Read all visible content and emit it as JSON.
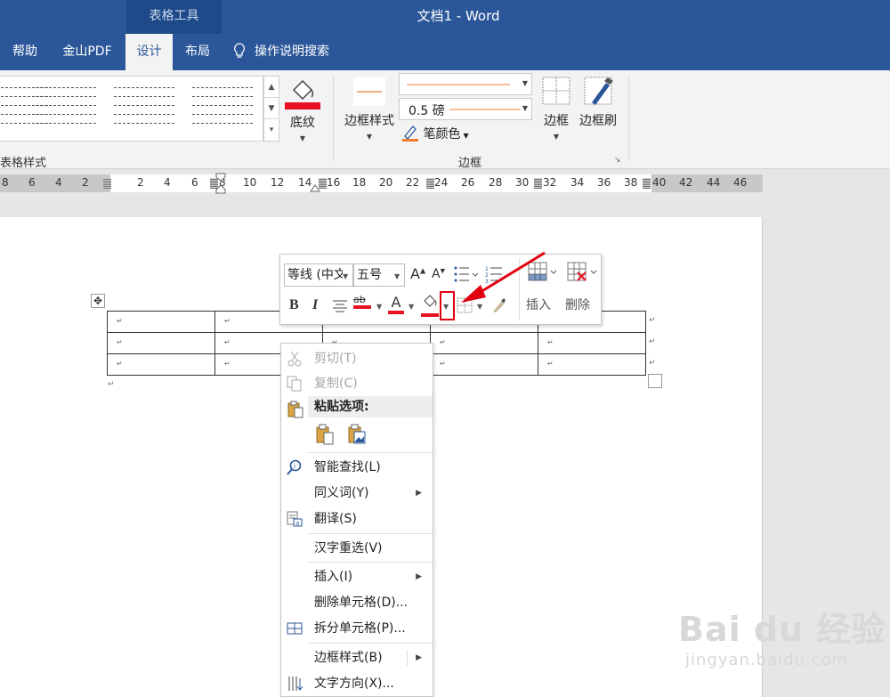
{
  "titlebar": {
    "context_tab": "表格工具",
    "document_title": "文档1  -  Word"
  },
  "tabs": [
    {
      "label": "帮助",
      "active": false
    },
    {
      "label": "金山PDF",
      "active": false
    },
    {
      "label": "设计",
      "active": true
    },
    {
      "label": "布局",
      "active": false
    }
  ],
  "tell_me": {
    "label": "操作说明搜索",
    "icon": "lightbulb-icon"
  },
  "ribbon": {
    "table_styles_group": "表格样式",
    "shading_label": "底纹",
    "shading_color": "#e81123",
    "border_styles_label": "边框样式",
    "line_weight_value": "0.5 磅",
    "pen_color_label": "笔颜色",
    "pen_color": "#ed7d31",
    "borders_label": "边框",
    "border_painter_label": "边框刷",
    "borders_group": "边框"
  },
  "ruler": {
    "left_ticks": [
      "8",
      "6",
      "4",
      "2"
    ],
    "right_ticks": [
      "2",
      "4",
      "6",
      "8",
      "10",
      "12",
      "14",
      "16",
      "18",
      "20",
      "22",
      "24",
      "26",
      "28",
      "30",
      "32",
      "34",
      "36",
      "38",
      "40",
      "42",
      "44",
      "46"
    ]
  },
  "document": {
    "rows": 3,
    "cols": 5,
    "cell_mark": "↵",
    "move_handle": "✥"
  },
  "mini_toolbar": {
    "font_name": "等线 (中文",
    "font_size": "五号",
    "grow_font": "A",
    "shrink_font": "A",
    "bold": "B",
    "italic": "I",
    "highlight": "ab",
    "font_color_letter": "A",
    "insert_label": "插入",
    "delete_label": "删除",
    "accent_red": "#e81123"
  },
  "context_menu": {
    "items": [
      {
        "label": "剪切(T)",
        "disabled": true,
        "icon": "scissors-icon"
      },
      {
        "label": "复制(C)",
        "disabled": true,
        "icon": "copy-icon"
      },
      {
        "label": "粘贴选项:",
        "header": true,
        "icon": "paste-icon"
      },
      {
        "label": "智能查找(L)",
        "icon": "smart-lookup-icon"
      },
      {
        "label": "同义词(Y)",
        "submenu": true
      },
      {
        "label": "翻译(S)",
        "icon": "translate-icon"
      },
      {
        "label": "汉字重选(V)"
      },
      {
        "label": "插入(I)",
        "submenu": true
      },
      {
        "label": "删除单元格(D)..."
      },
      {
        "label": "拆分单元格(P)...",
        "icon": "split-cells-icon"
      },
      {
        "label": "边框样式(B)",
        "submenu": true
      },
      {
        "label": "文字方向(X)...",
        "icon": "text-direction-icon"
      }
    ]
  },
  "annotation": {
    "color": "#e1000f"
  },
  "watermark": {
    "brand": "Bai du 经验",
    "url": "jingyan.baidu.com"
  }
}
